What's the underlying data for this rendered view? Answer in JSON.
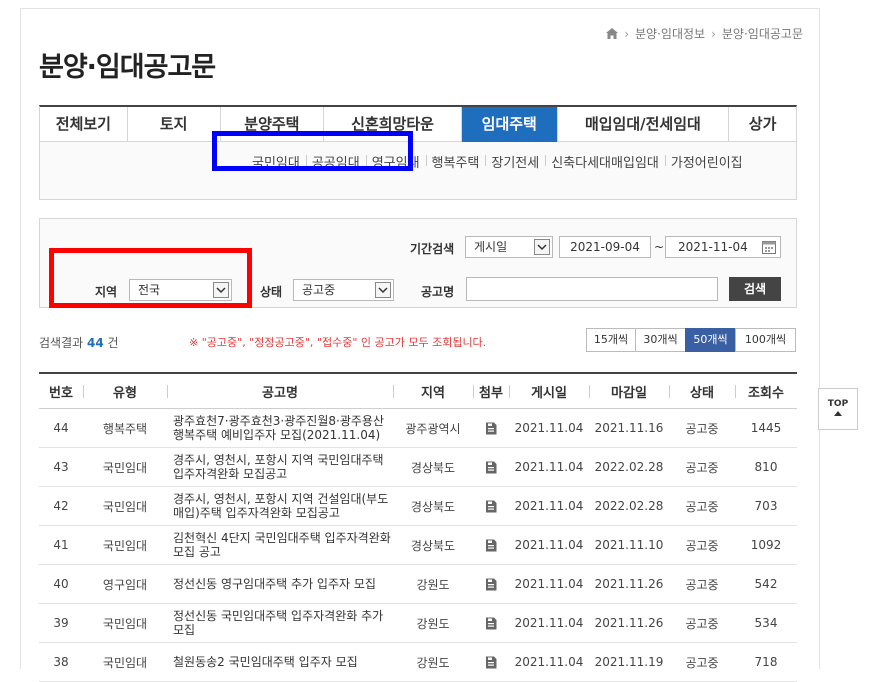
{
  "breadcrumb": {
    "items": [
      "분양·임대정보",
      "분양·임대공고문"
    ]
  },
  "page_title": "분양·임대공고문",
  "tabs": [
    {
      "label": "전체보기",
      "active": false
    },
    {
      "label": "토지",
      "active": false
    },
    {
      "label": "분양주택",
      "active": false
    },
    {
      "label": "신혼희망타운",
      "active": false
    },
    {
      "label": "임대주택",
      "active": true
    },
    {
      "label": "매입임대/전세임대",
      "active": false
    },
    {
      "label": "상가",
      "active": false
    }
  ],
  "subtabs": [
    "국민임대",
    "공공임대",
    "영구임대",
    "행복주택",
    "장기전세",
    "신축다세대매입임대",
    "가정어린이집"
  ],
  "search": {
    "period_label": "기간검색",
    "period_type": "게시일",
    "date_from": "2021-09-04",
    "date_sep": "~",
    "date_to": "2021-11-04",
    "region_label": "지역",
    "region_value": "전국",
    "status_label": "상태",
    "status_value": "공고중",
    "title_label": "공고명",
    "title_value": "",
    "button_label": "검색"
  },
  "results": {
    "prefix": "검색결과",
    "count": "44",
    "suffix": "건",
    "notice": "※ \"공고중\", \"정정공고중\", \"접수중\" 인 공고가 모두 조회됩니다."
  },
  "page_sizes": [
    {
      "label": "15개씩",
      "active": false
    },
    {
      "label": "30개씩",
      "active": false
    },
    {
      "label": "50개씩",
      "active": true
    },
    {
      "label": "100개씩",
      "active": false
    }
  ],
  "table": {
    "headers": [
      "번호",
      "유형",
      "공고명",
      "지역",
      "첨부",
      "게시일",
      "마감일",
      "상태",
      "조회수"
    ],
    "rows": [
      {
        "no": "44",
        "type": "행복주택",
        "title": "광주효천7·광주효천3·광주진월8·광주용산 행복주택 예비입주자 모집(2021.11.04)",
        "region": "광주광역시",
        "posted": "2021.11.04",
        "deadline": "2021.11.16",
        "status": "공고중",
        "views": "1445"
      },
      {
        "no": "43",
        "type": "국민임대",
        "title": "경주시, 영천시, 포항시 지역 국민임대주택 입주자격완화 모집공고",
        "region": "경상북도",
        "posted": "2021.11.04",
        "deadline": "2022.02.28",
        "status": "공고중",
        "views": "810"
      },
      {
        "no": "42",
        "type": "국민임대",
        "title": "경주시, 영천시, 포항시 지역 건설임대(부도매입)주택 입주자격완화 모집공고",
        "region": "경상북도",
        "posted": "2021.11.04",
        "deadline": "2022.02.28",
        "status": "공고중",
        "views": "703"
      },
      {
        "no": "41",
        "type": "국민임대",
        "title": "김천혁신 4단지 국민임대주택 입주자격완화 모집 공고",
        "region": "경상북도",
        "posted": "2021.11.04",
        "deadline": "2021.11.10",
        "status": "공고중",
        "views": "1092"
      },
      {
        "no": "40",
        "type": "영구임대",
        "title": "정선신동 영구임대주택 추가 입주자 모집",
        "region": "강원도",
        "posted": "2021.11.04",
        "deadline": "2021.11.26",
        "status": "공고중",
        "views": "542"
      },
      {
        "no": "39",
        "type": "국민임대",
        "title": "정선신동 국민임대주택 입주자격완화 추가모집",
        "region": "강원도",
        "posted": "2021.11.04",
        "deadline": "2021.11.26",
        "status": "공고중",
        "views": "534"
      },
      {
        "no": "38",
        "type": "국민임대",
        "title": "철원동송2 국민임대주택 입주자 모집",
        "region": "강원도",
        "posted": "2021.11.04",
        "deadline": "2021.11.19",
        "status": "공고중",
        "views": "718"
      }
    ]
  },
  "top_button": "TOP",
  "colors": {
    "accent": "#1f6dbd",
    "highlight_blue": "#0000ff",
    "highlight_red": "#ff0000",
    "notice": "#e03a3a"
  }
}
